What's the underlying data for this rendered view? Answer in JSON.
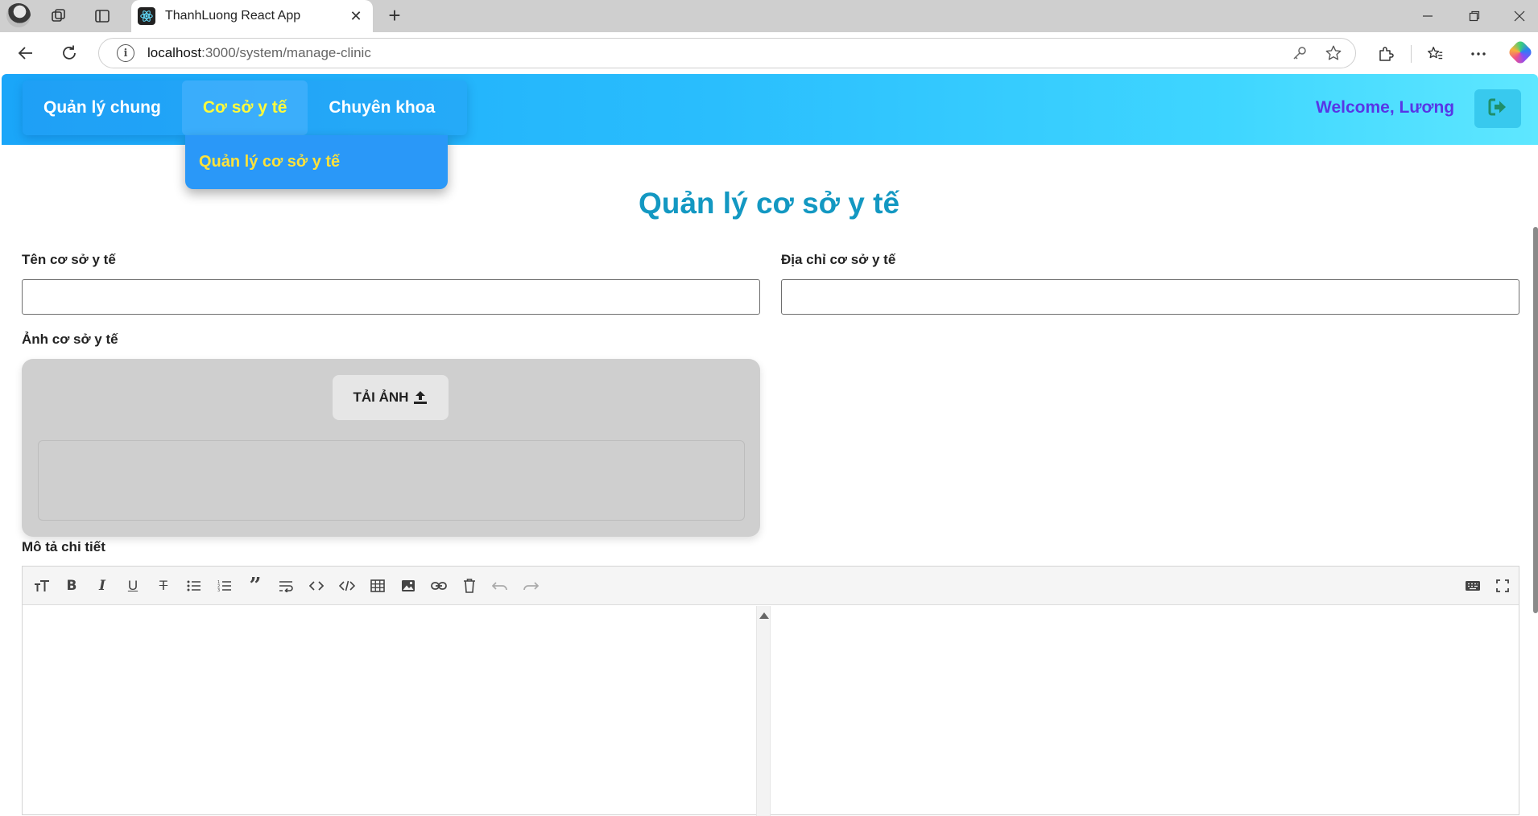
{
  "browser": {
    "tab_title": "ThanhLuong React App",
    "url_host": "localhost",
    "url_path": ":3000/system/manage-clinic"
  },
  "header": {
    "menu": [
      {
        "label": "Quản lý chung"
      },
      {
        "label": "Cơ sở y tế"
      },
      {
        "label": "Chuyên khoa"
      }
    ],
    "dropdown_item": "Quản lý cơ sở y tế",
    "welcome": "Welcome, Lương",
    "colors": {
      "welcome": "#5836e6",
      "active_menu": "#fffb3a",
      "header_start": "#1aa6f9",
      "header_end": "#5ee7ff"
    }
  },
  "page": {
    "title": "Quản lý cơ sở y tế",
    "name_label": "Tên cơ sở y tế",
    "name_value": "",
    "address_label": "Địa chỉ cơ sở y tế",
    "address_value": "",
    "image_label": "Ảnh cơ sở y tế",
    "upload_label": "TẢI ẢNH",
    "description_label": "Mô tả chi tiết"
  },
  "editor_tools": [
    "header-icon",
    "bold-icon",
    "italic-icon",
    "underline-icon",
    "strikethrough-icon",
    "unordered-list-icon",
    "ordered-list-icon",
    "blockquote-icon",
    "wrap-text-icon",
    "inline-code-icon",
    "code-block-icon",
    "table-icon",
    "image-icon",
    "link-icon",
    "clear-icon",
    "undo-icon",
    "redo-icon",
    "keyboard-icon",
    "fullscreen-icon"
  ]
}
